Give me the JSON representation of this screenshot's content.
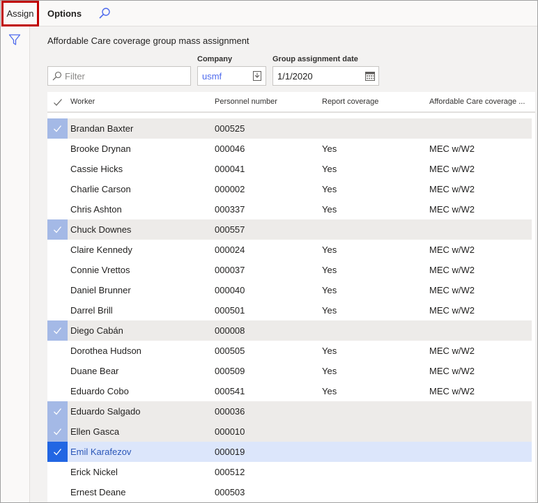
{
  "toolbar": {
    "assign_label": "Assign",
    "options_label": "Options",
    "search_icon": "search-icon"
  },
  "leftrail": {
    "filter_icon": "filter-icon"
  },
  "page": {
    "title": "Affordable Care coverage group mass assignment"
  },
  "filters": {
    "filter_placeholder": "Filter",
    "company_label": "Company",
    "company_value": "usmf",
    "date_label": "Group assignment date",
    "date_value": "1/1/2020"
  },
  "grid": {
    "columns": [
      "Worker",
      "Personnel number",
      "Report coverage",
      "Affordable Care coverage ..."
    ],
    "rows": [
      {
        "worker": "Brandan Baxter",
        "pn": "000525",
        "rc": "",
        "acc": "",
        "state": "marked"
      },
      {
        "worker": "Brooke Drynan",
        "pn": "000046",
        "rc": "Yes",
        "acc": "MEC w/W2",
        "state": ""
      },
      {
        "worker": "Cassie Hicks",
        "pn": "000041",
        "rc": "Yes",
        "acc": "MEC w/W2",
        "state": ""
      },
      {
        "worker": "Charlie Carson",
        "pn": "000002",
        "rc": "Yes",
        "acc": "MEC w/W2",
        "state": ""
      },
      {
        "worker": "Chris Ashton",
        "pn": "000337",
        "rc": "Yes",
        "acc": "MEC w/W2",
        "state": ""
      },
      {
        "worker": "Chuck Downes",
        "pn": "000557",
        "rc": "",
        "acc": "",
        "state": "marked"
      },
      {
        "worker": "Claire Kennedy",
        "pn": "000024",
        "rc": "Yes",
        "acc": "MEC w/W2",
        "state": ""
      },
      {
        "worker": "Connie Vrettos",
        "pn": "000037",
        "rc": "Yes",
        "acc": "MEC w/W2",
        "state": ""
      },
      {
        "worker": "Daniel Brunner",
        "pn": "000040",
        "rc": "Yes",
        "acc": "MEC w/W2",
        "state": ""
      },
      {
        "worker": "Darrel Brill",
        "pn": "000501",
        "rc": "Yes",
        "acc": "MEC w/W2",
        "state": ""
      },
      {
        "worker": "Diego Cabán",
        "pn": "000008",
        "rc": "",
        "acc": "",
        "state": "marked"
      },
      {
        "worker": "Dorothea Hudson",
        "pn": "000505",
        "rc": "Yes",
        "acc": "MEC w/W2",
        "state": ""
      },
      {
        "worker": "Duane Bear",
        "pn": "000509",
        "rc": "Yes",
        "acc": "MEC w/W2",
        "state": ""
      },
      {
        "worker": "Eduardo Cobo",
        "pn": "000541",
        "rc": "Yes",
        "acc": "MEC w/W2",
        "state": ""
      },
      {
        "worker": "Eduardo Salgado",
        "pn": "000036",
        "rc": "",
        "acc": "",
        "state": "marked"
      },
      {
        "worker": "Ellen Gasca",
        "pn": "000010",
        "rc": "",
        "acc": "",
        "state": "marked"
      },
      {
        "worker": "Emil Karafezov",
        "pn": "000019",
        "rc": "",
        "acc": "",
        "state": "active"
      },
      {
        "worker": "Erick Nickel",
        "pn": "000512",
        "rc": "",
        "acc": "",
        "state": ""
      },
      {
        "worker": "Ernest Deane",
        "pn": "000503",
        "rc": "",
        "acc": "",
        "state": ""
      }
    ]
  },
  "colors": {
    "accent": "#2266e3",
    "marked_check": "#a4b9e6",
    "marked_row": "#edebe9",
    "active_row": "#dce6fb",
    "highlight_border": "#c00000"
  }
}
